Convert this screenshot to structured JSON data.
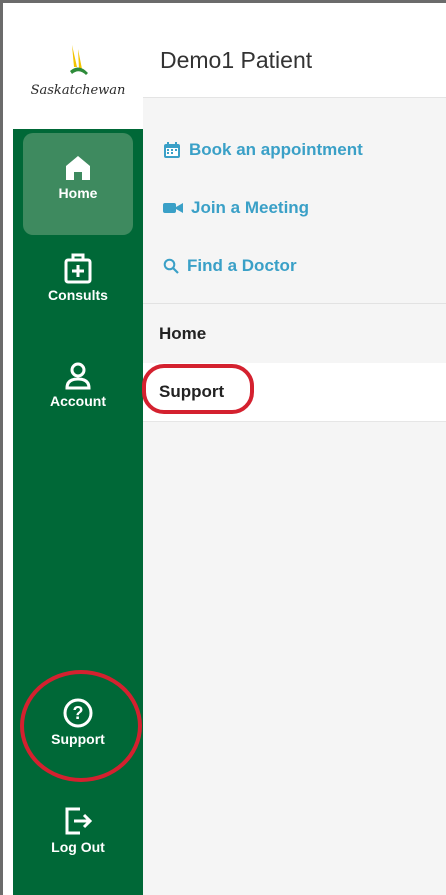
{
  "brand": {
    "logo_text": "Saskatchewan"
  },
  "header": {
    "patient_name": "Demo1 Patient"
  },
  "sidebar": {
    "items": [
      {
        "label": "Home",
        "icon": "home-icon",
        "active": true
      },
      {
        "label": "Consults",
        "icon": "medical-kit-icon"
      },
      {
        "label": "Account",
        "icon": "person-icon"
      },
      {
        "label": "Support",
        "icon": "question-circle-icon"
      },
      {
        "label": "Log Out",
        "icon": "logout-icon"
      }
    ]
  },
  "quick_links": [
    {
      "label": "Book an appointment",
      "icon": "calendar-icon"
    },
    {
      "label": "Join a Meeting",
      "icon": "video-camera-icon"
    },
    {
      "label": "Find a Doctor",
      "icon": "search-icon"
    }
  ],
  "menu": {
    "items": [
      {
        "label": "Home"
      },
      {
        "label": "Support"
      }
    ]
  },
  "colors": {
    "sidebar_green": "#006837",
    "active_tab": "#3e8a5f",
    "link_blue": "#3aa0c7",
    "highlight_red": "#d4212f"
  }
}
